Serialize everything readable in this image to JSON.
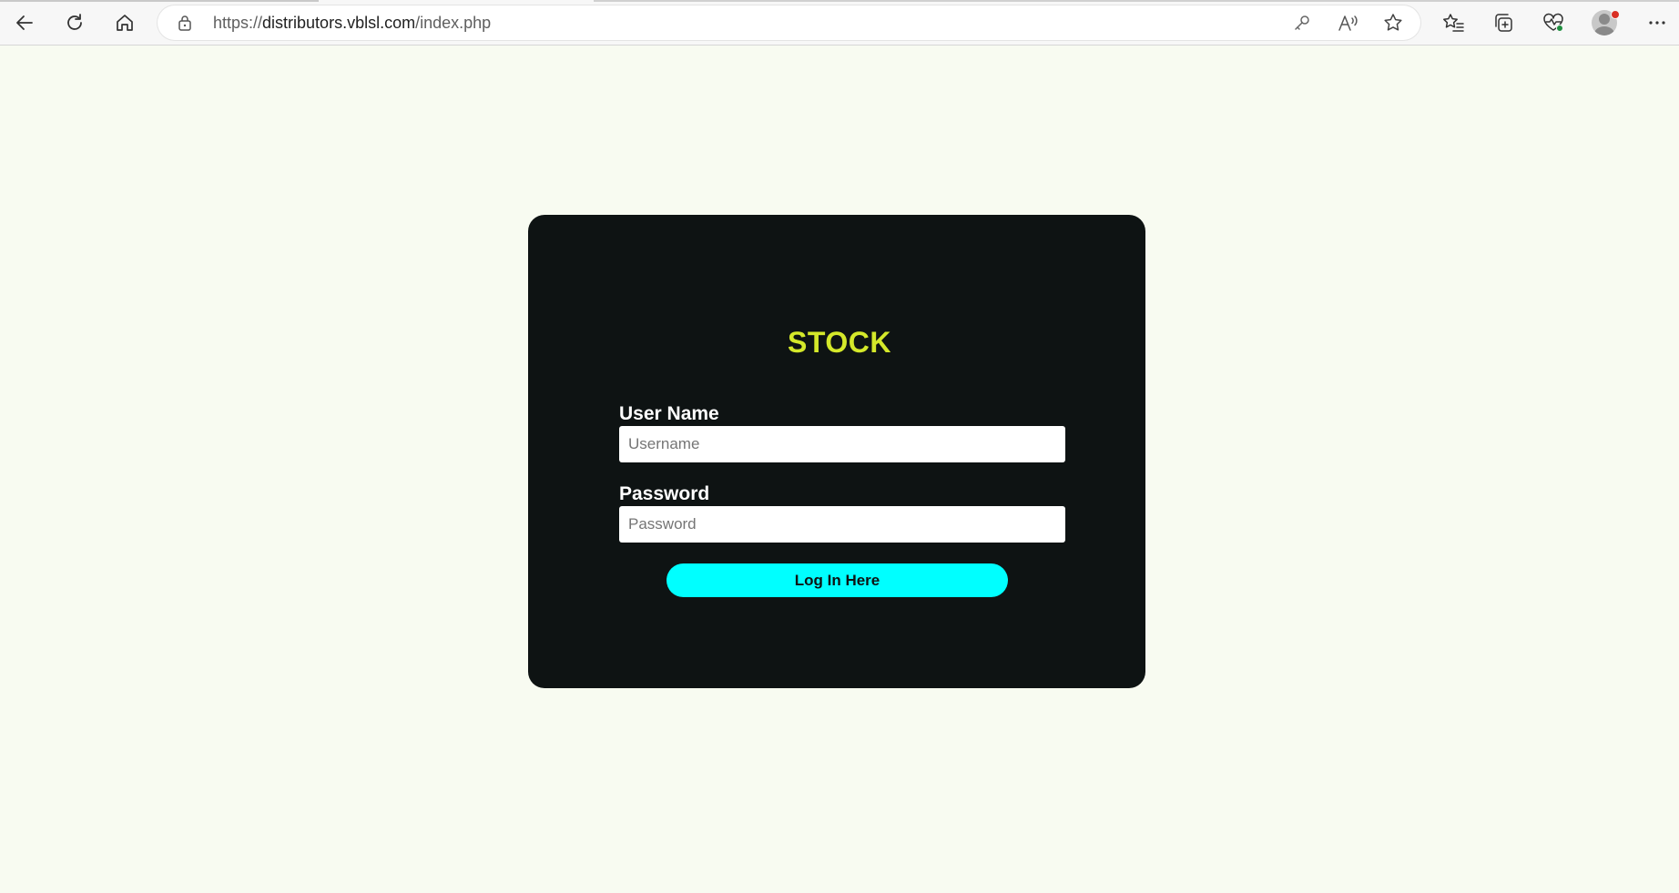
{
  "browser": {
    "url_prefix": "https://",
    "url_host": "distributors.vblsl.com",
    "url_path": "/index.php",
    "icons": {
      "back": "back-arrow-icon",
      "refresh": "refresh-icon",
      "home": "home-icon",
      "lock": "lock-icon",
      "key": "key-icon",
      "read_aloud": "read-aloud-icon",
      "favorite": "star-icon",
      "favorites_list": "favorites-icon",
      "collections": "collections-icon",
      "performance": "heart-pulse-icon",
      "profile": "profile-avatar",
      "more": "more-icon"
    }
  },
  "login": {
    "title": "STOCK",
    "username_label": "User Name",
    "username_placeholder": "Username",
    "username_value": "",
    "password_label": "Password",
    "password_placeholder": "Password",
    "password_value": "",
    "submit_label": "Log In Here"
  },
  "colors": {
    "page_background": "#f8fbf1",
    "card_background": "#0e1313",
    "title": "#d4e82a",
    "button": "#00ffff",
    "label": "#ffffff"
  }
}
